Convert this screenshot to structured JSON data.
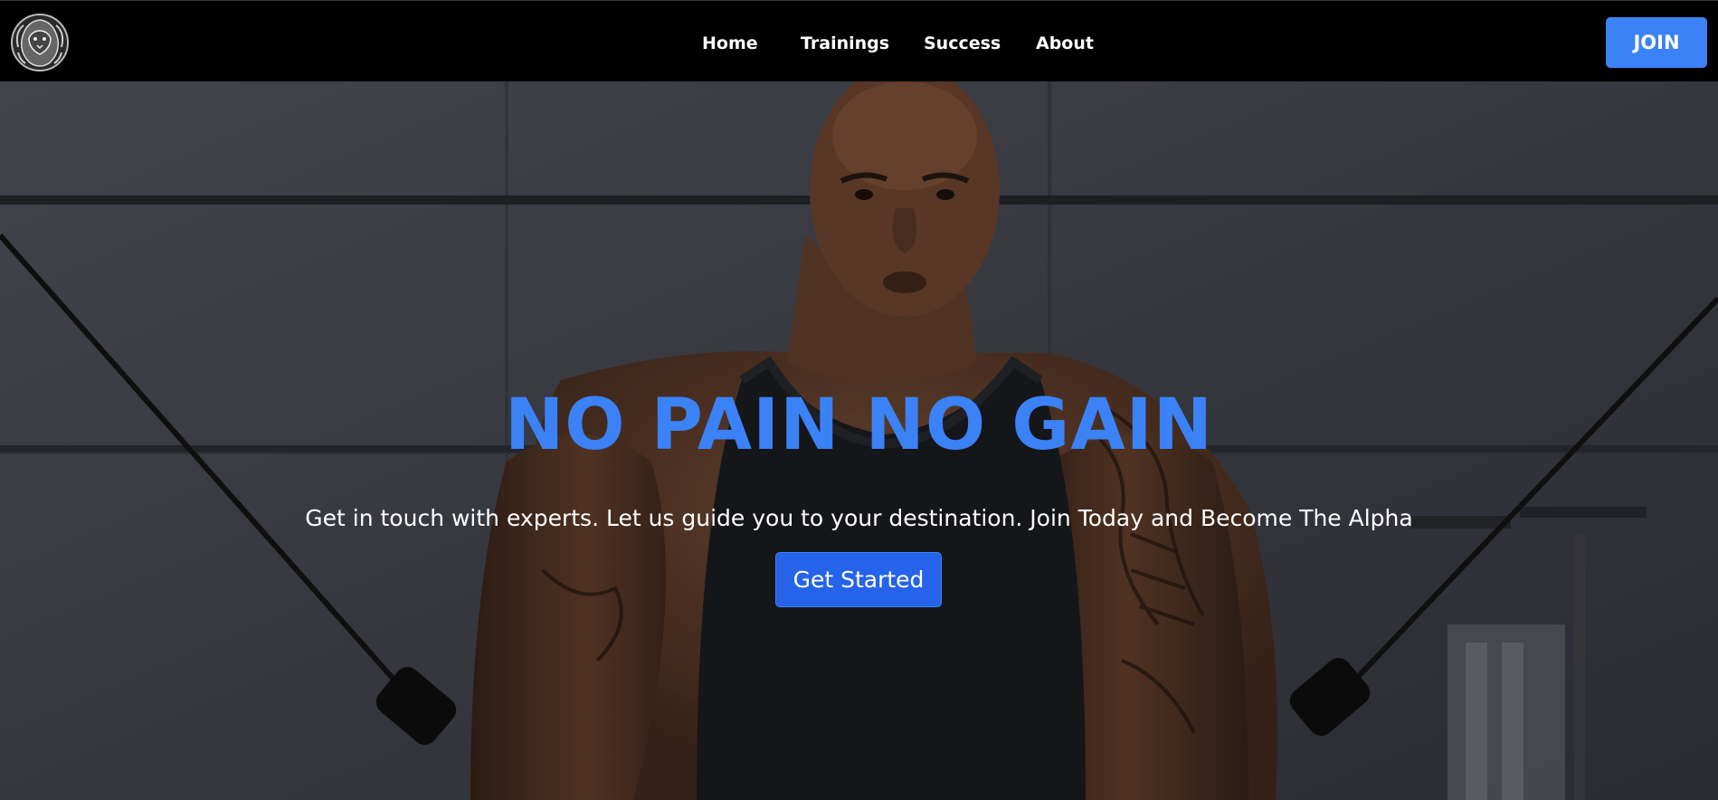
{
  "nav": {
    "logo_icon": "lion-head-logo",
    "links": [
      {
        "label": "Home"
      },
      {
        "label": "Trainings"
      },
      {
        "label": "Success"
      },
      {
        "label": "About"
      }
    ],
    "join_label": "JOIN"
  },
  "hero": {
    "title": "NO PAIN NO GAIN",
    "subtitle": "Get in touch with experts. Let us guide you to your destination. Join Today and Become The Alpha",
    "cta_label": "Get Started",
    "background": "gym-athlete-photo"
  },
  "colors": {
    "accent": "#3b82f6",
    "nav_bg": "#000000",
    "text": "#ffffff"
  }
}
